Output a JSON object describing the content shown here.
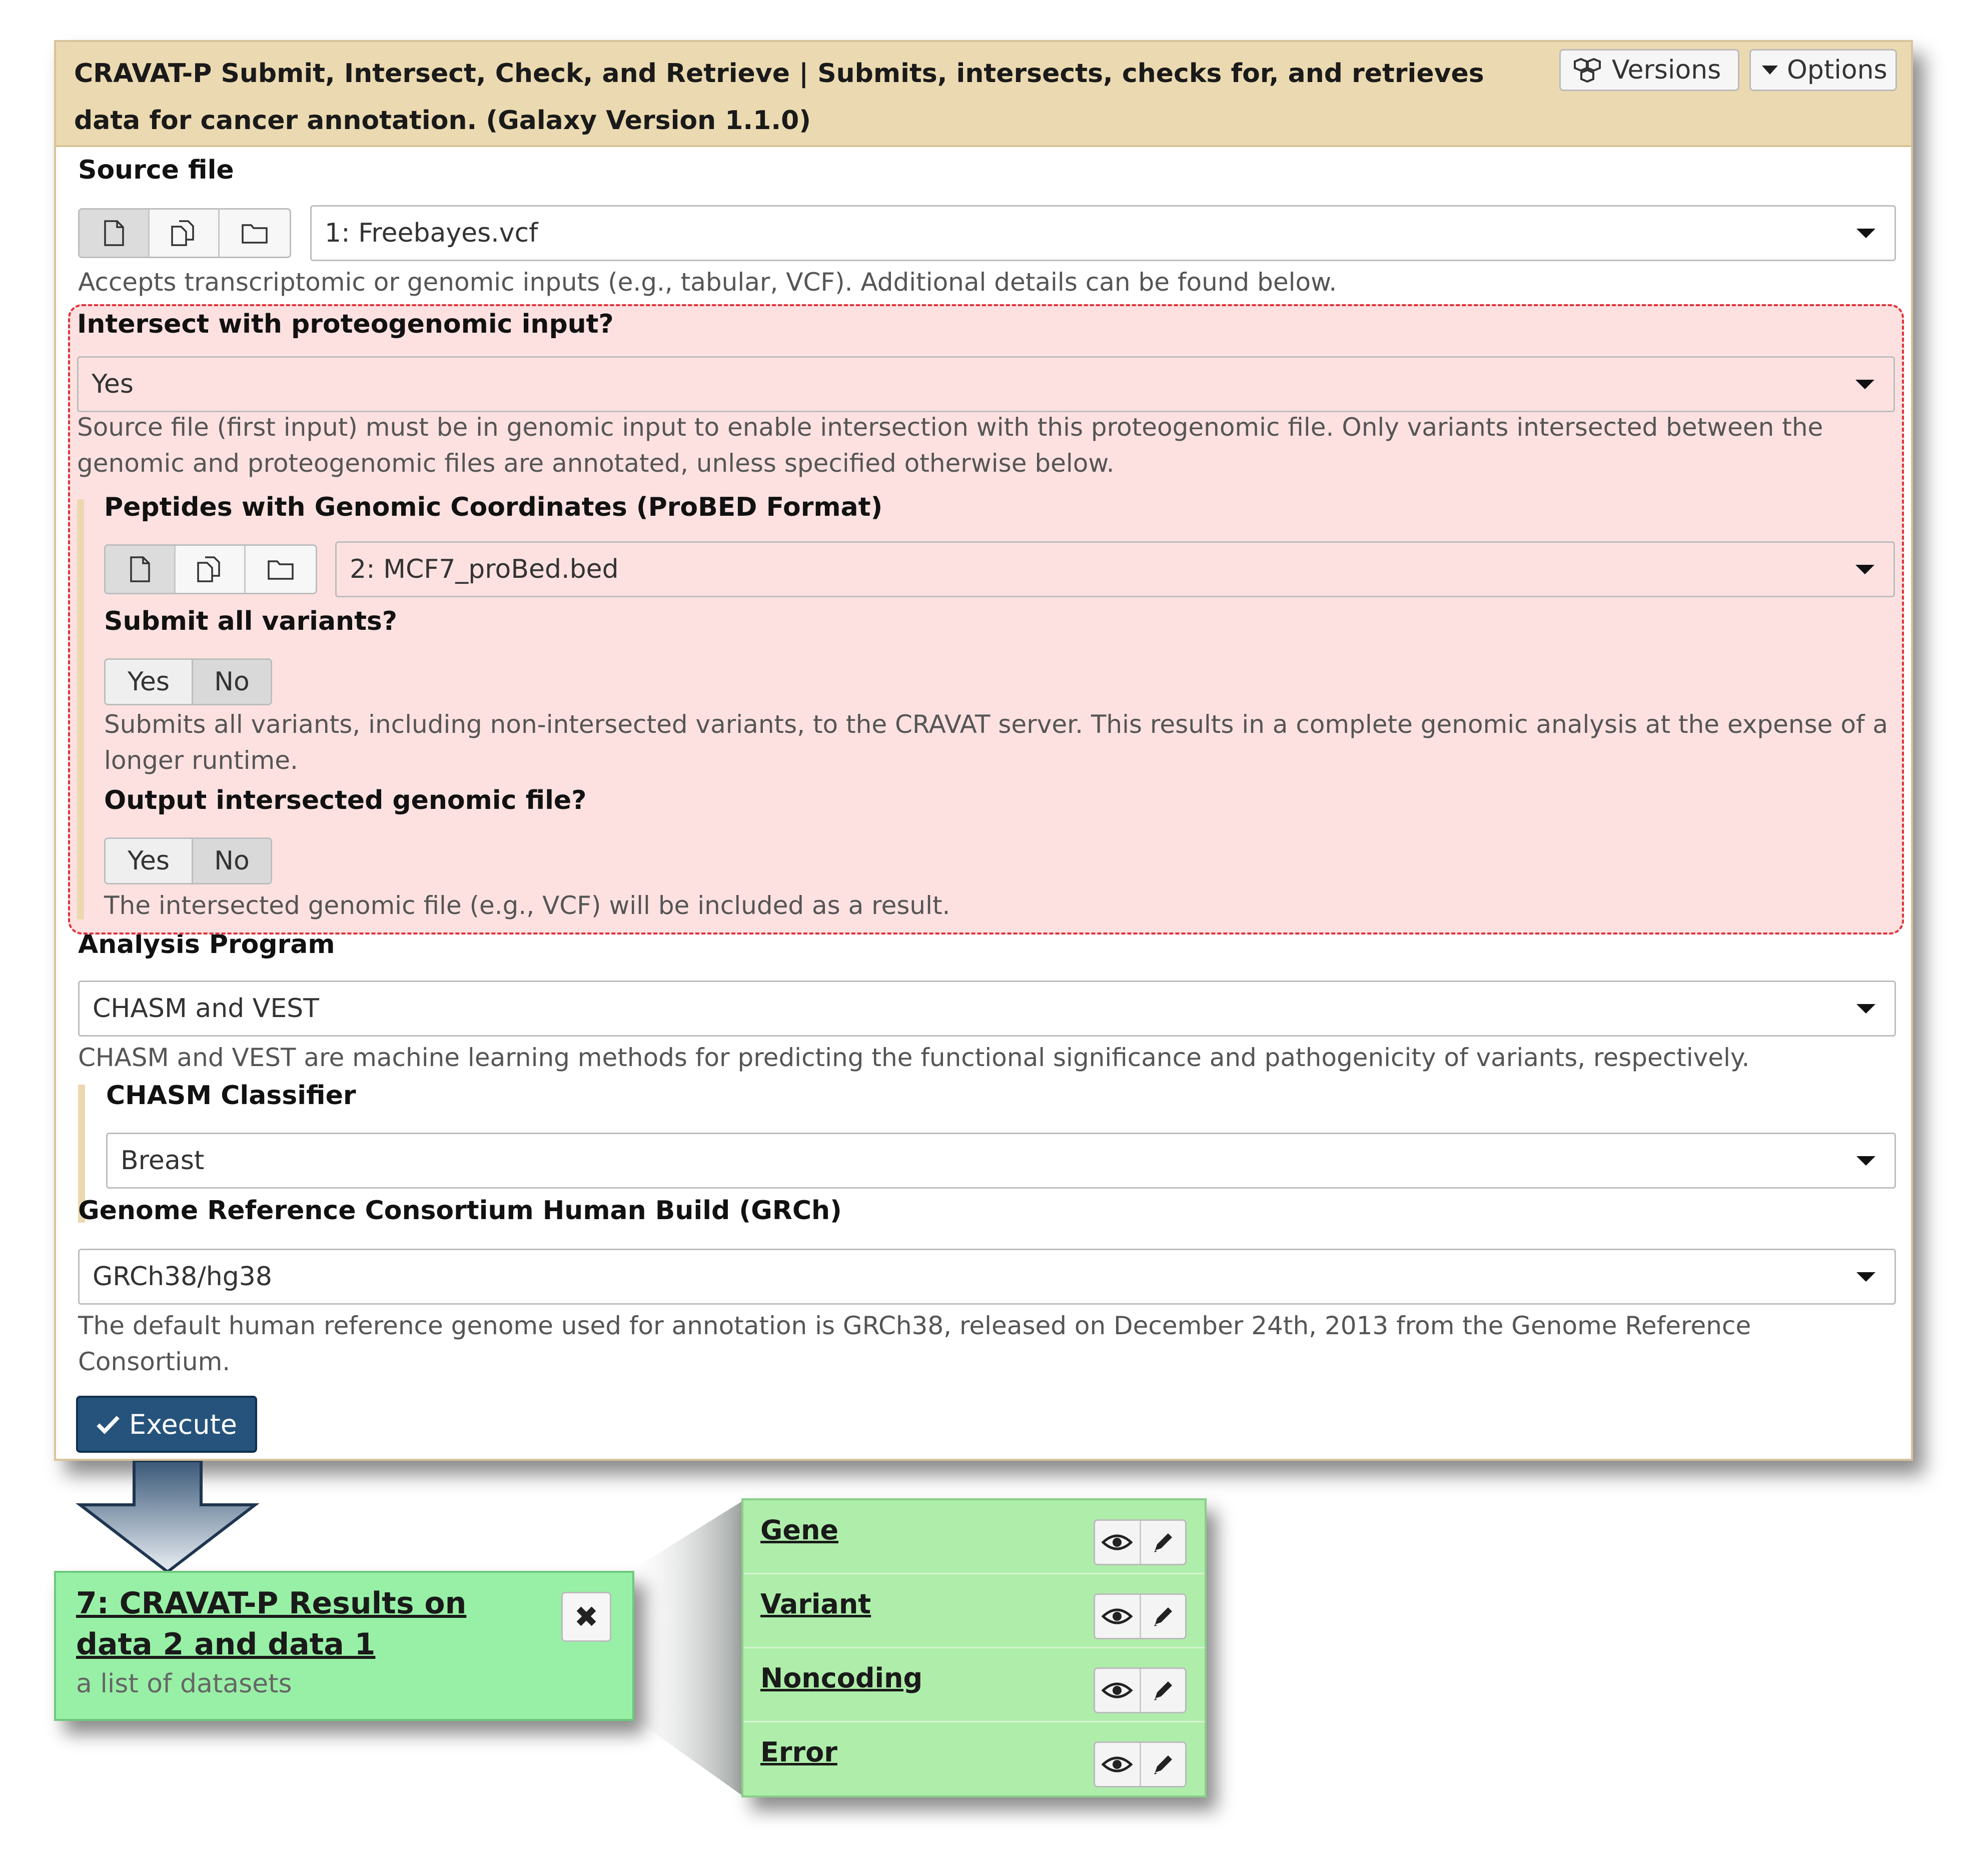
{
  "tool": {
    "title": "CRAVAT-P Submit, Intersect, Check, and Retrieve | Submits, intersects, checks for, and retrieves data for cancer annotation. (Galaxy Version 1.1.0)",
    "versions_label": "Versions",
    "options_label": "Options"
  },
  "source_file": {
    "label": "Source file",
    "value": "1: Freebayes.vcf",
    "help": "Accepts transcriptomic or genomic inputs (e.g., tabular, VCF). Additional details can be found below."
  },
  "intersect": {
    "label": "Intersect with proteogenomic input?",
    "value": "Yes",
    "help": "Source file (first input) must be in genomic input to enable intersection with this proteogenomic file. Only variants intersected between the genomic and proteogenomic files are annotated, unless specified otherwise below.",
    "peptides": {
      "label": "Peptides with Genomic Coordinates (ProBED Format)",
      "value": "2: MCF7_proBed.bed"
    },
    "submit_all": {
      "label": "Submit all variants?",
      "yes": "Yes",
      "no": "No",
      "selected": "No",
      "help": "Submits all variants, including non-intersected variants, to the CRAVAT server. This results in a complete genomic analysis at the expense of a longer runtime."
    },
    "output_intersected": {
      "label": "Output intersected genomic file?",
      "yes": "Yes",
      "no": "No",
      "selected": "No",
      "help": "The intersected genomic file (e.g., VCF) will be included as a result."
    }
  },
  "analysis": {
    "label": "Analysis Program",
    "value": "CHASM and VEST",
    "help": "CHASM and VEST are machine learning methods for predicting the functional significance and pathogenicity of variants, respectively.",
    "classifier_label": "CHASM Classifier",
    "classifier_value": "Breast"
  },
  "genome": {
    "label": "Genome Reference Consortium Human Build (GRCh)",
    "value": "GRCh38/hg38",
    "help": "The default human reference genome used for annotation is GRCh38, released on December 24th, 2013 from the Genome Reference Consortium."
  },
  "execute_label": "Execute",
  "result": {
    "title": "7: CRAVAT-P Results on data 2 and data 1",
    "subtitle": "a list of datasets"
  },
  "datasets": [
    "Gene",
    "Variant",
    "Noncoding",
    "Error"
  ],
  "colors": {
    "header_bg": "#ebdab1",
    "error_region": "#fde1e1",
    "error_border": "#e0323a",
    "execute": "#25537b",
    "result_bg": "#98f0a6"
  },
  "icons": [
    "cubes-icon",
    "caret-down-icon",
    "file-icon",
    "files-icon",
    "folder-icon",
    "check-icon",
    "close-icon",
    "eye-icon",
    "pencil-icon"
  ]
}
